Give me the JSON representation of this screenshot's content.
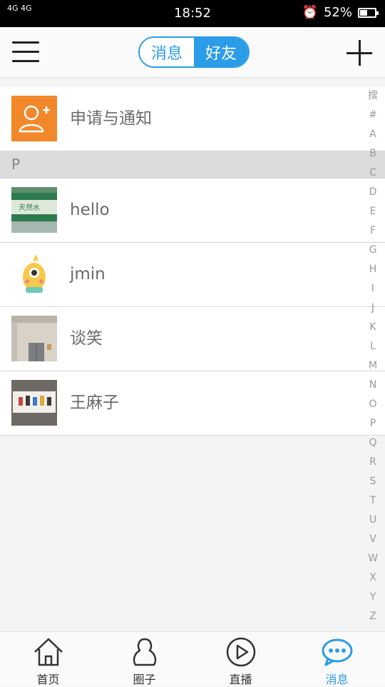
{
  "status": {
    "network_top": "4G 4G",
    "time": "18:52",
    "battery": "52%",
    "battery_level": 0.52
  },
  "header": {
    "tabs": [
      {
        "label": "消息",
        "active": false
      },
      {
        "label": "好友",
        "active": true
      }
    ]
  },
  "notifications": {
    "label": "申请与通知",
    "icon": "add-user-icon"
  },
  "section_letter": "P",
  "contacts": [
    {
      "name": "hello"
    },
    {
      "name": "jmin"
    },
    {
      "name": "谈笑"
    },
    {
      "name": "王麻子"
    }
  ],
  "alpha_index": [
    "搜",
    "#",
    "A",
    "B",
    "C",
    "D",
    "E",
    "F",
    "G",
    "H",
    "I",
    "J",
    "K",
    "L",
    "M",
    "N",
    "O",
    "P",
    "Q",
    "R",
    "S",
    "T",
    "U",
    "V",
    "W",
    "X",
    "Y",
    "Z"
  ],
  "tabbar": {
    "items": [
      {
        "label": "首页",
        "icon": "home-icon"
      },
      {
        "label": "圈子",
        "icon": "circle-icon"
      },
      {
        "label": "直播",
        "icon": "play-icon"
      },
      {
        "label": "消息",
        "icon": "message-icon"
      }
    ],
    "active_index": 3
  },
  "colors": {
    "accent": "#2a9ce8",
    "notify": "#f2882a"
  }
}
